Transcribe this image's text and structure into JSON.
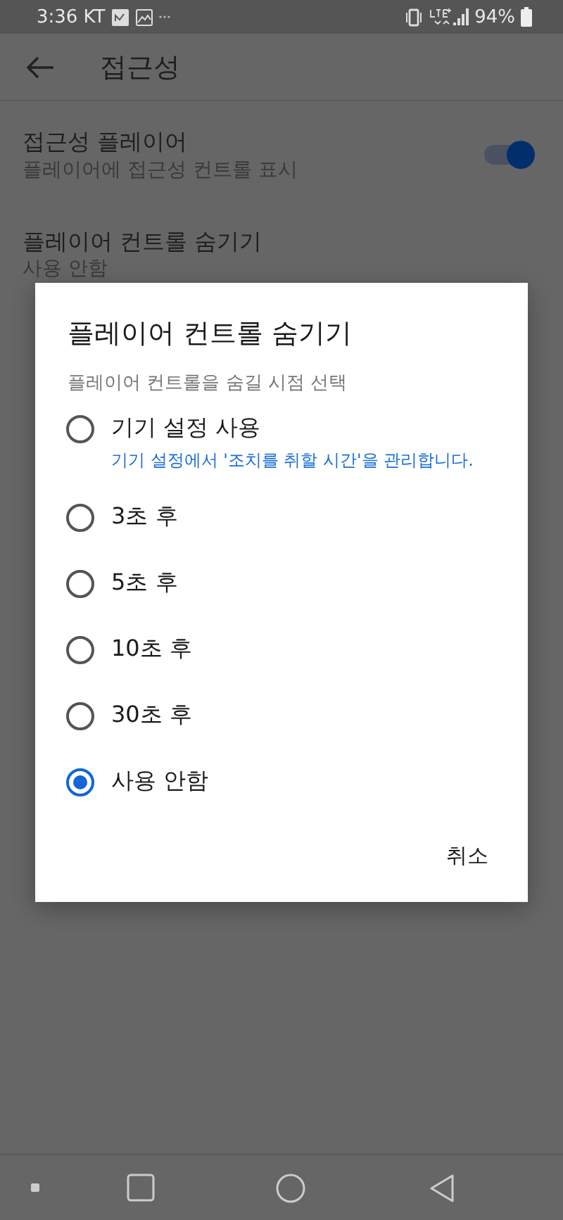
{
  "status_bar": {
    "time": "3:36",
    "carrier": "KT",
    "battery": "94%"
  },
  "toolbar": {
    "title": "접근성"
  },
  "settings": [
    {
      "kind": "toggle",
      "title": "접근성 플레이어",
      "subtitle": "플레이어에 접근성 컨트롤 표시",
      "on": true
    },
    {
      "kind": "text",
      "title": "플레이어 컨트롤 숨기기",
      "subtitle": "사용 안함"
    }
  ],
  "dialog": {
    "title": "플레이어 컨트롤 숨기기",
    "subtitle": "플레이어 컨트롤을 숨길 시점 선택",
    "options": [
      {
        "label": "기기 설정 사용",
        "hint": "기기 설정에서 '조치를 취할 시간'을 관리합니다.",
        "selected": false
      },
      {
        "label": "3초 후",
        "selected": false
      },
      {
        "label": "5초 후",
        "selected": false
      },
      {
        "label": "10초 후",
        "selected": false
      },
      {
        "label": "30초 후",
        "selected": false
      },
      {
        "label": "사용 안함",
        "selected": true
      }
    ],
    "cancel": "취소"
  }
}
